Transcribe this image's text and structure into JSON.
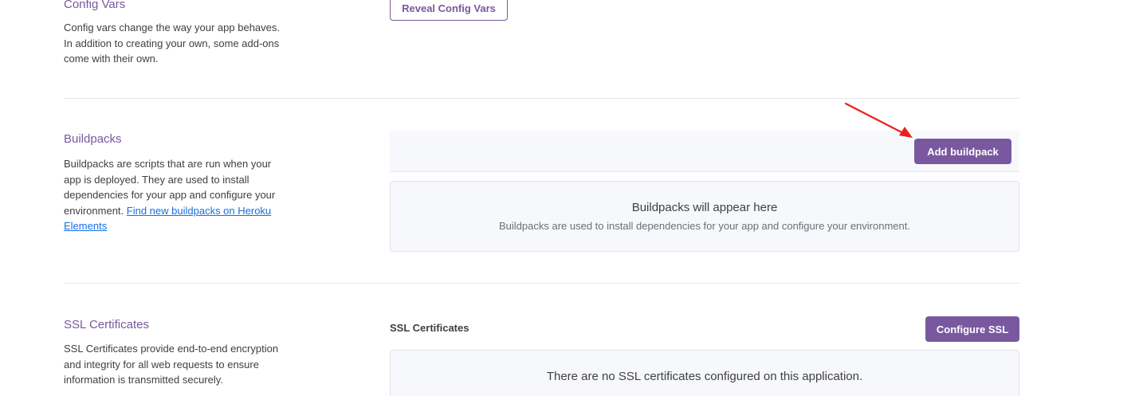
{
  "config_vars": {
    "title": "Config Vars",
    "description": "Config vars change the way your app behaves. In addition to creating your own, some add-ons come with their own.",
    "reveal_button": "Reveal Config Vars"
  },
  "buildpacks": {
    "title": "Buildpacks",
    "description": "Buildpacks are scripts that are run when your app is deployed. They are used to install dependencies for your app and configure your environment.",
    "link_text": "Find new buildpacks on Heroku Elements",
    "add_button": "Add buildpack",
    "empty_title": "Buildpacks will appear here",
    "empty_subtitle": "Buildpacks are used to install dependencies for your app and configure your environment."
  },
  "ssl": {
    "title": "SSL Certificates",
    "description": "SSL Certificates provide end-to-end encryption and integrity for all web requests to ensure information is transmitted securely.",
    "heading": "SSL Certificates",
    "configure_button": "Configure SSL",
    "empty_title": "There are no SSL certificates configured on this application."
  },
  "colors": {
    "accent": "#79589f",
    "link": "#1570e7",
    "annotation_arrow": "#e8211e"
  }
}
